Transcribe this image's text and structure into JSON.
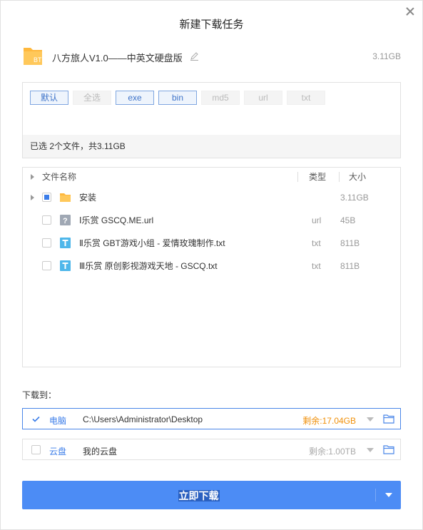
{
  "dialog": {
    "title": "新建下载任务"
  },
  "task": {
    "icon_label": "BT",
    "name": "八方旅人V1.0——中英文硬盘版",
    "size": "3.11GB"
  },
  "filters": {
    "tags": [
      {
        "label": "默认",
        "active": true
      },
      {
        "label": "全选",
        "active": false
      },
      {
        "label": "exe",
        "active": true
      },
      {
        "label": "bin",
        "active": true
      },
      {
        "label": "md5",
        "active": false
      },
      {
        "label": "url",
        "active": false
      },
      {
        "label": "txt",
        "active": false
      }
    ],
    "status": "已选 2个文件，共3.11GB"
  },
  "file_list": {
    "headers": {
      "name": "文件名称",
      "type": "类型",
      "size": "大小"
    },
    "rows": [
      {
        "name": "安装",
        "type": "",
        "size": "3.11GB",
        "icon": "folder-icon",
        "checked": "partial",
        "expandable": true
      },
      {
        "name": "Ⅰ乐赏 GSCQ.ME.url",
        "type": "url",
        "size": "45B",
        "icon": "unknown-file-icon",
        "checked": "unchecked",
        "expandable": false
      },
      {
        "name": "Ⅱ乐赏 GBT游戏小组 - 爱情玫瑰制作.txt",
        "type": "txt",
        "size": "811B",
        "icon": "text-file-icon",
        "checked": "unchecked",
        "expandable": false
      },
      {
        "name": "Ⅲ乐赏 原创影视游戏天地 - GSCQ.txt",
        "type": "txt",
        "size": "811B",
        "icon": "text-file-icon",
        "checked": "unchecked",
        "expandable": false
      }
    ]
  },
  "download_to": {
    "label": "下载到：",
    "destinations": [
      {
        "name": "电脑",
        "path": "C:\\Users\\Administrator\\Desktop",
        "free": "剩余:17.04GB",
        "free_color": "#f0900a",
        "checked": true
      },
      {
        "name": "云盘",
        "path": "我的云盘",
        "free": "剩余:1.00TB",
        "free_color": "#aaaaaa",
        "checked": false
      }
    ]
  },
  "actions": {
    "download_now": "立即下载"
  },
  "colors": {
    "accent": "#4c8cf5",
    "folder": "#ffb83d",
    "text_icon": "#4fb7ea"
  }
}
